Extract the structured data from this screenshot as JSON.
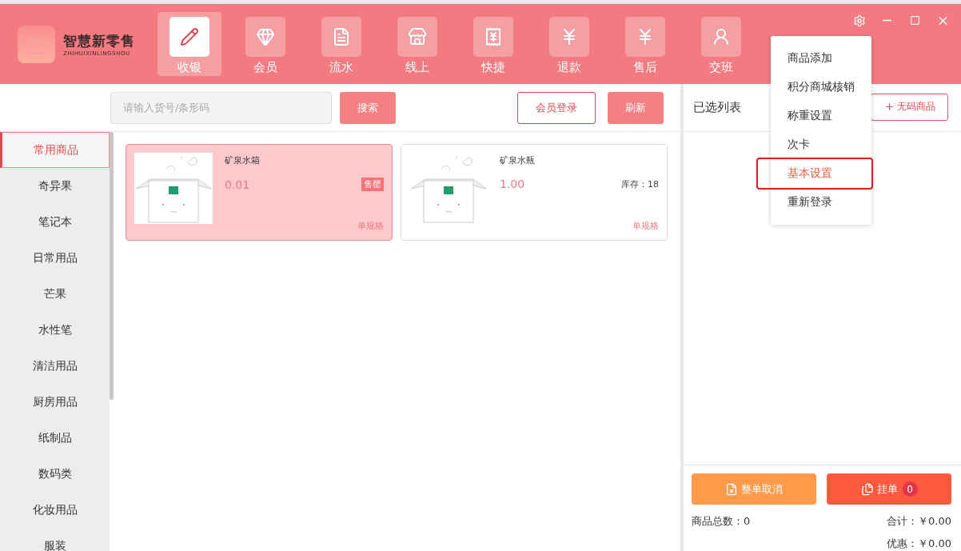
{
  "logo": {
    "title": "智慧新零售",
    "subtitle": "ZHIHUIXINLINGSHOU"
  },
  "nav": [
    {
      "label": "收银",
      "selected": true
    },
    {
      "label": "会员",
      "selected": false
    },
    {
      "label": "流水",
      "selected": false
    },
    {
      "label": "线上",
      "selected": false
    },
    {
      "label": "快捷",
      "selected": false
    },
    {
      "label": "退款",
      "selected": false
    },
    {
      "label": "售后",
      "selected": false
    },
    {
      "label": "交班",
      "selected": false
    }
  ],
  "settings_menu": [
    {
      "label": "商品添加",
      "selected": false
    },
    {
      "label": "积分商城核销",
      "selected": false
    },
    {
      "label": "称重设置",
      "selected": false
    },
    {
      "label": "次卡",
      "selected": false
    },
    {
      "label": "基本设置",
      "selected": true
    },
    {
      "label": "重新登录",
      "selected": false
    }
  ],
  "search": {
    "placeholder": "请输入货号/条形码",
    "button": "搜索"
  },
  "toolbar_buttons": [
    "会员登录",
    "刷新"
  ],
  "categories": [
    {
      "label": "常用商品",
      "selected": true
    },
    {
      "label": "奇异果",
      "selected": false
    },
    {
      "label": "笔记本",
      "selected": false
    },
    {
      "label": "日常用品",
      "selected": false
    },
    {
      "label": "芒果",
      "selected": false
    },
    {
      "label": "水性笔",
      "selected": false
    },
    {
      "label": "清洁用品",
      "selected": false
    },
    {
      "label": "厨房用品",
      "selected": false
    },
    {
      "label": "纸制品",
      "selected": false
    },
    {
      "label": "数码类",
      "selected": false
    },
    {
      "label": "化妆用品",
      "selected": false
    },
    {
      "label": "服装",
      "selected": false
    }
  ],
  "products": [
    {
      "name": "矿泉水箱",
      "price": "0.01",
      "badge": "售罄",
      "spec": "单规格",
      "selected": true
    },
    {
      "name": "矿泉水瓶",
      "price": "1.00",
      "stock": "库存：18",
      "spec": "单规格",
      "selected": false
    }
  ],
  "cart": {
    "title": "已选列表",
    "add_button": "无码商品",
    "cancel_button": "整单取消",
    "hold_button": "挂单",
    "hold_count": "0",
    "total_count": "商品总数：0",
    "total": "合计：￥0.00",
    "discount": "优惠：￥0.00"
  }
}
